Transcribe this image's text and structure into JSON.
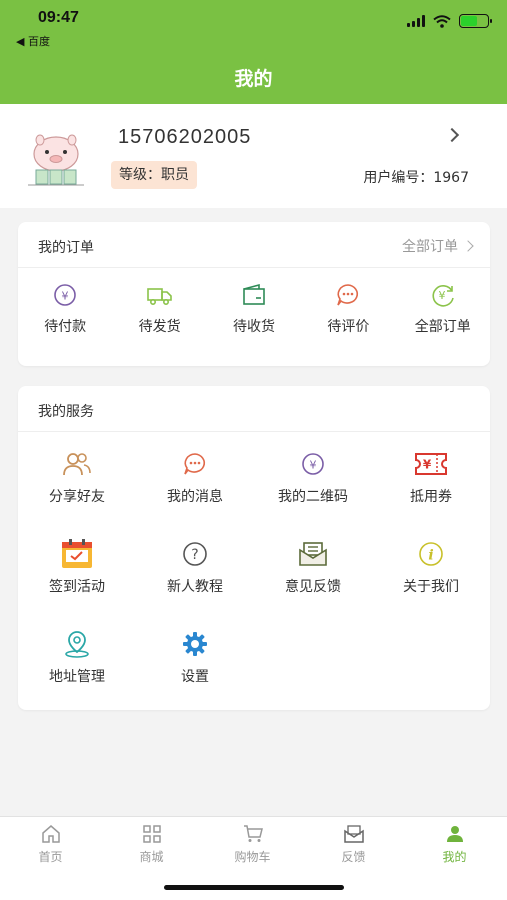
{
  "status": {
    "time": "09:47",
    "back_app": "◀ 百度"
  },
  "nav": {
    "title": "我的"
  },
  "profile": {
    "phone": "15706202005",
    "level": "等级：职员",
    "user_id": "用户编号：1967"
  },
  "orders": {
    "title": "我的订单",
    "all_link": "全部订单",
    "items": [
      {
        "label": "待付款",
        "icon": "yen-circle-icon",
        "color": "#7b5ea7"
      },
      {
        "label": "待发货",
        "icon": "truck-icon",
        "color": "#8bc34a"
      },
      {
        "label": "待收货",
        "icon": "wallet-icon",
        "color": "#2e8b57"
      },
      {
        "label": "待评价",
        "icon": "chat-bubble-icon",
        "color": "#e0694a"
      },
      {
        "label": "全部订单",
        "icon": "yen-refresh-icon",
        "color": "#8bc34a"
      }
    ]
  },
  "services": {
    "title": "我的服务",
    "items": [
      {
        "label": "分享好友",
        "icon": "users-icon"
      },
      {
        "label": "我的消息",
        "icon": "message-icon"
      },
      {
        "label": "我的二维码",
        "icon": "yen-circle-icon"
      },
      {
        "label": "抵用券",
        "icon": "coupon-icon"
      },
      {
        "label": "签到活动",
        "icon": "calendar-check-icon"
      },
      {
        "label": "新人教程",
        "icon": "help-icon"
      },
      {
        "label": "意见反馈",
        "icon": "envelope-icon"
      },
      {
        "label": "关于我们",
        "icon": "info-icon"
      },
      {
        "label": "地址管理",
        "icon": "location-icon"
      },
      {
        "label": "设置",
        "icon": "gear-icon"
      }
    ]
  },
  "tabbar": {
    "items": [
      {
        "label": "首页",
        "icon": "home-icon"
      },
      {
        "label": "商城",
        "icon": "grid-icon"
      },
      {
        "label": "购物车",
        "icon": "cart-icon"
      },
      {
        "label": "反馈",
        "icon": "mail-icon"
      },
      {
        "label": "我的",
        "icon": "person-icon",
        "active": true
      }
    ],
    "active_color": "#6fb33c"
  },
  "colors": {
    "brand": "#7ac143",
    "level_bg": "#fce4d4"
  }
}
